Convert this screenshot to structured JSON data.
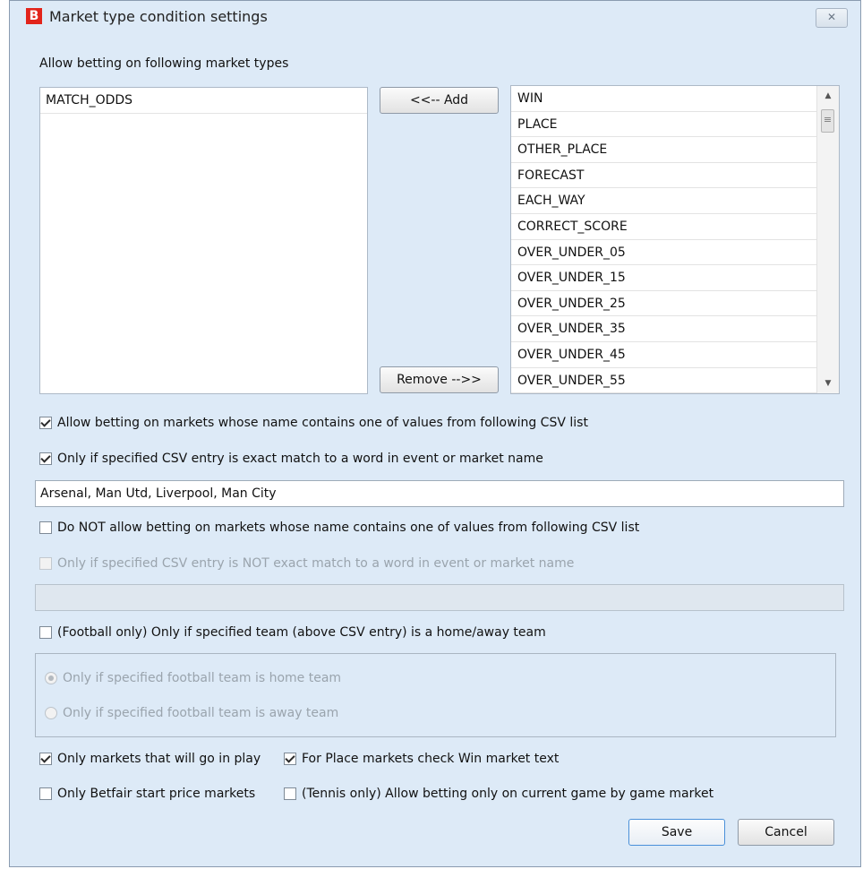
{
  "window": {
    "title": "Market type condition settings",
    "close_glyph": "✕",
    "app_icon": "B"
  },
  "market_types": {
    "label": "Allow betting on following market types",
    "selected": [
      "MATCH_ODDS"
    ],
    "available": [
      "WIN",
      "PLACE",
      "OTHER_PLACE",
      "FORECAST",
      "EACH_WAY",
      "CORRECT_SCORE",
      "OVER_UNDER_05",
      "OVER_UNDER_15",
      "OVER_UNDER_25",
      "OVER_UNDER_35",
      "OVER_UNDER_45",
      "OVER_UNDER_55"
    ],
    "add_label": "<<-- Add",
    "remove_label": "Remove -->>"
  },
  "allow_csv": {
    "label": "Allow betting on markets whose name contains one of values from following CSV list",
    "checked": true,
    "exact_label": "Only if specified CSV entry is exact match to a word in event or market name",
    "exact_checked": true,
    "value": "Arsenal, Man Utd, Liverpool, Man City"
  },
  "disallow_csv": {
    "label": "Do NOT allow betting on markets whose name contains one of values from following CSV list",
    "checked": false,
    "exact_label": "Only if specified CSV entry is NOT exact match to a word in event or market name",
    "exact_checked": false,
    "value": ""
  },
  "football": {
    "label": "(Football only) Only if specified team (above CSV entry) is a home/away team",
    "checked": false,
    "home_label": "Only if specified football team is home team",
    "away_label": "Only if specified football team is away team"
  },
  "options": {
    "in_play_label": "Only markets that will go in play",
    "in_play_checked": true,
    "place_win_label": "For Place markets check Win market text",
    "place_win_checked": true,
    "sp_label": "Only Betfair start price markets",
    "sp_checked": false,
    "tennis_label": "(Tennis only) Allow betting only on current game by game market",
    "tennis_checked": false
  },
  "footer": {
    "save_label": "Save",
    "cancel_label": "Cancel"
  }
}
